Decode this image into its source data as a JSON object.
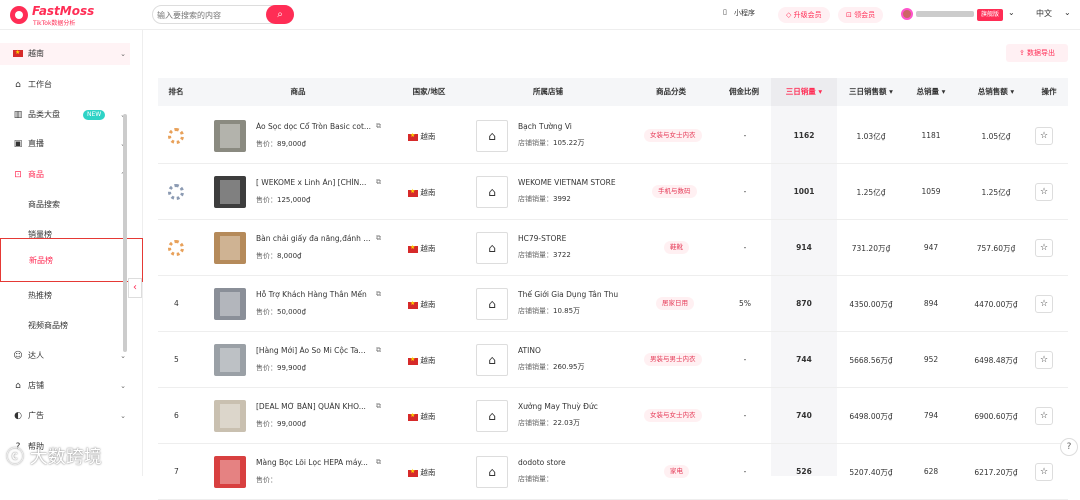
{
  "brand": {
    "name": "FastMoss",
    "sub": "TikTok数据分析"
  },
  "search": {
    "placeholder": "输入要搜索的内容",
    "button_icon": "search-icon"
  },
  "top": {
    "mini": "小程序",
    "upgrade": "升级会员",
    "vip": "领会员",
    "flag_badge": "旗舰版",
    "lang": "中文"
  },
  "sidebar": {
    "region": "越南",
    "items": [
      {
        "label": "工作台",
        "icon": "home-icon"
      },
      {
        "label": "品类大盘",
        "icon": "chart-icon",
        "tag": "NEW"
      },
      {
        "label": "直播",
        "icon": "live-icon"
      },
      {
        "label": "商品",
        "icon": "bag-icon"
      }
    ],
    "sub": [
      "商品搜索",
      "销量榜",
      "新品榜",
      "热推榜",
      "视频商品榜"
    ],
    "lower": [
      {
        "label": "达人",
        "icon": "user-icon"
      },
      {
        "label": "店铺",
        "icon": "shop-icon"
      },
      {
        "label": "广告",
        "icon": "ad-icon"
      },
      {
        "label": "帮助",
        "icon": "help-icon"
      }
    ]
  },
  "export_label": "数据导出",
  "table": {
    "headers": [
      "排名",
      "商品",
      "国家/地区",
      "所属店铺",
      "商品分类",
      "佣金比例",
      "三日销量",
      "三日销售额",
      "总销量",
      "总销售额",
      "操作"
    ],
    "price_label": "售价：",
    "shop_sales_label": "店铺销量：",
    "rows": [
      {
        "rank": "",
        "medal": "gold",
        "name": "Áo Sọc dọc Cổ Tròn Basic cot...",
        "price": "89,000₫",
        "country": "越南",
        "shop": "Bạch Tường Vi",
        "shop_sales": "105.22万",
        "category": "女装与女士内衣",
        "commission": "-",
        "sales3": "1162",
        "revenue3": "1.03亿₫",
        "total_sales": "1181",
        "total_revenue": "1.05亿₫"
      },
      {
        "rank": "",
        "medal": "silver",
        "name": "[ WEKOME x Linh Ản] [CHÍN...",
        "price": "125,000₫",
        "country": "越南",
        "shop": "WEKOME VIETNAM STORE",
        "shop_sales": "3992",
        "category": "手机与数码",
        "commission": "-",
        "sales3": "1001",
        "revenue3": "1.25亿₫",
        "total_sales": "1059",
        "total_revenue": "1.25亿₫"
      },
      {
        "rank": "",
        "medal": "bronze",
        "name": "Bàn chải giấy đa năng,đánh ...",
        "price": "8,000₫",
        "country": "越南",
        "shop": "HC79-STORE",
        "shop_sales": "3722",
        "category": "鞋靴",
        "commission": "-",
        "sales3": "914",
        "revenue3": "731.20万₫",
        "total_sales": "947",
        "total_revenue": "757.60万₫"
      },
      {
        "rank": "4",
        "medal": "",
        "name": "Hỗ Trợ Khách Hàng Thân Mến",
        "price": "50,000₫",
        "country": "越南",
        "shop": "Thế Giới Gia Dụng Tân Thu",
        "shop_sales": "10.85万",
        "category": "居家日用",
        "commission": "5%",
        "sales3": "870",
        "revenue3": "4350.00万₫",
        "total_sales": "894",
        "total_revenue": "4470.00万₫"
      },
      {
        "rank": "5",
        "medal": "",
        "name": "[Hàng Mới] Áo So Mi Cộc Ta...",
        "price": "99,900₫",
        "country": "越南",
        "shop": "ATINO",
        "shop_sales": "260.95万",
        "category": "男装与男士内衣",
        "commission": "-",
        "sales3": "744",
        "revenue3": "5668.56万₫",
        "total_sales": "952",
        "total_revenue": "6498.48万₫"
      },
      {
        "rank": "6",
        "medal": "",
        "name": "[DEAL MỞ BÁN] QUẦN KHO...",
        "price": "99,000₫",
        "country": "越南",
        "shop": "Xưởng May Thuỳ Đức",
        "shop_sales": "22.03万",
        "category": "女装与女士内衣",
        "commission": "-",
        "sales3": "740",
        "revenue3": "6498.00万₫",
        "total_sales": "794",
        "total_revenue": "6900.60万₫"
      },
      {
        "rank": "7",
        "medal": "",
        "name": "Màng Bọc Lõi Lọc HEPA máy...",
        "price": "",
        "country": "越南",
        "shop": "dodoto store",
        "shop_sales": "",
        "category": "家电",
        "commission": "-",
        "sales3": "526",
        "revenue3": "5207.40万₫",
        "total_sales": "628",
        "total_revenue": "6217.20万₫"
      }
    ]
  },
  "watermark": "大数跨境",
  "colors": {
    "brand": "#ff2d55",
    "active_border": "#e53935"
  }
}
